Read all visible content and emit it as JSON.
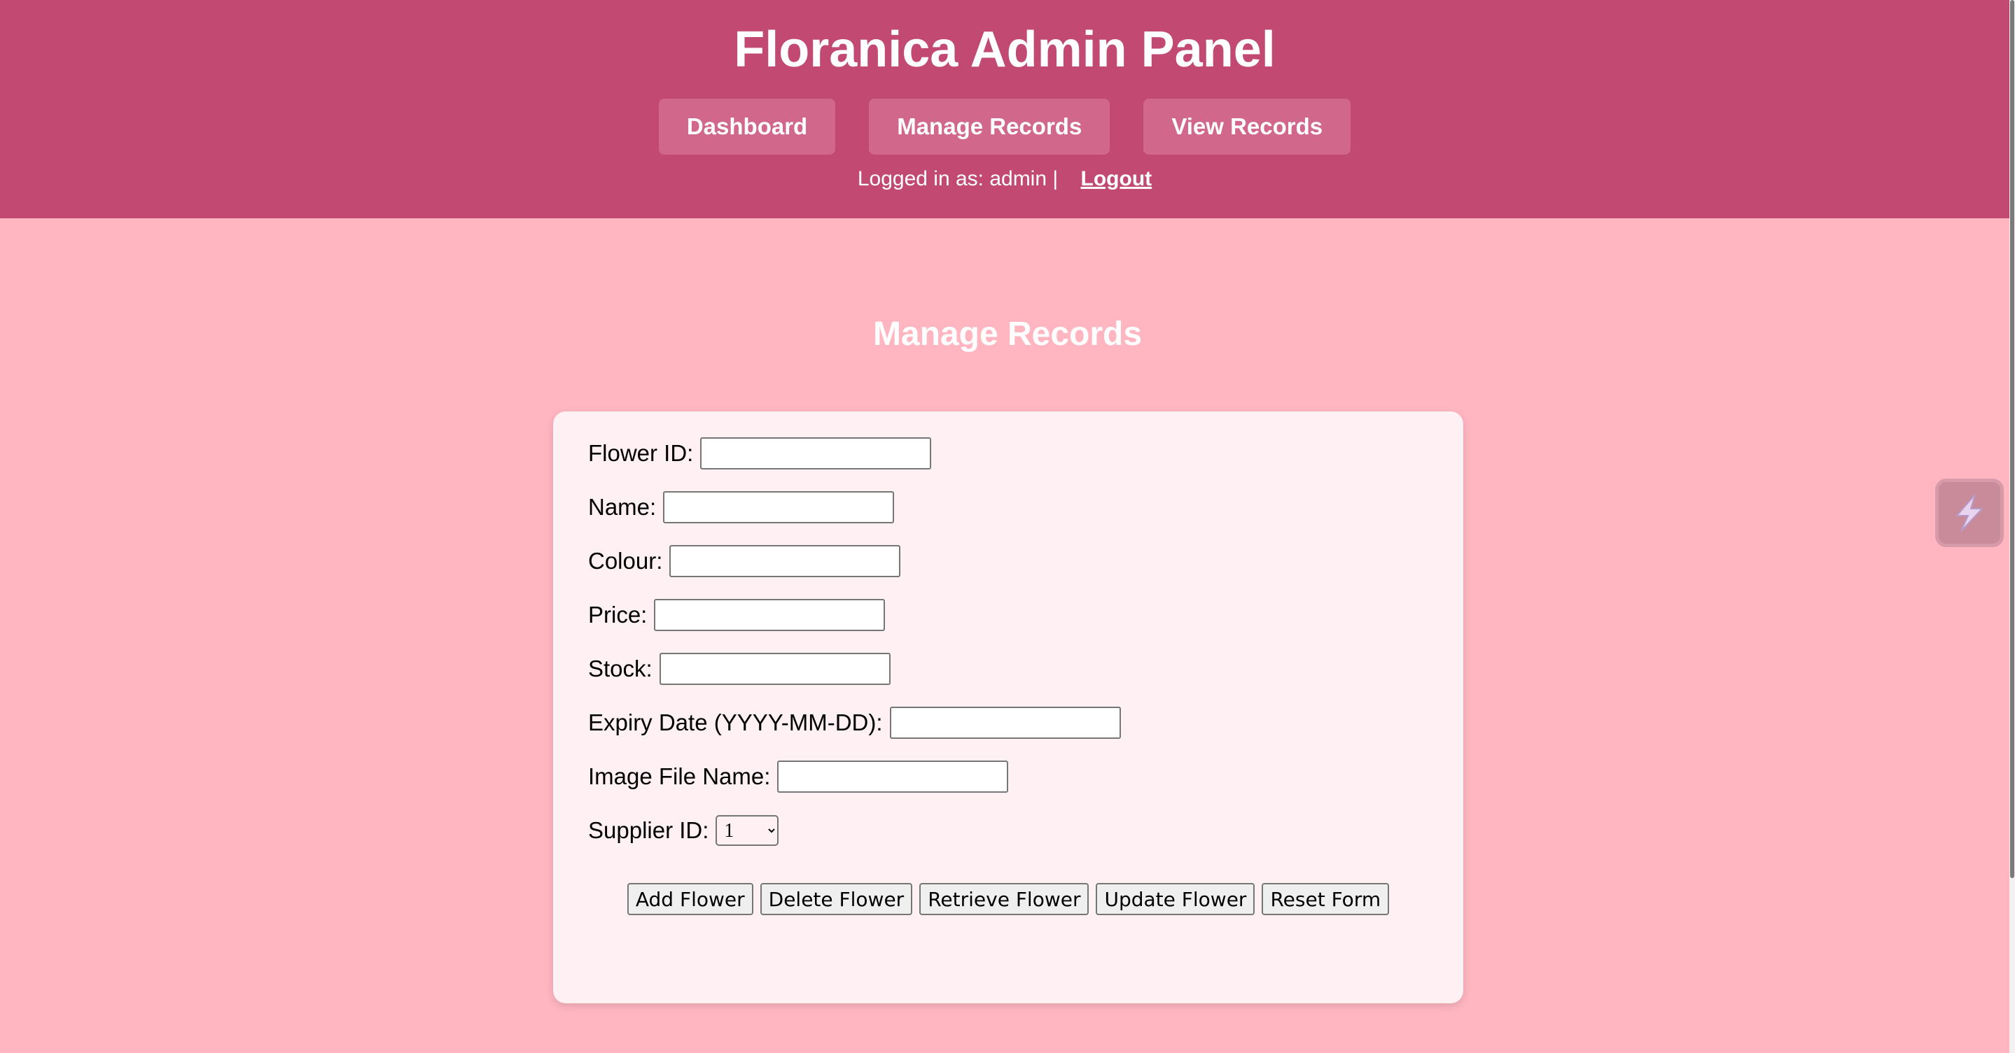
{
  "header": {
    "title": "Floranica Admin Panel",
    "nav": [
      {
        "label": "Dashboard"
      },
      {
        "label": "Manage Records"
      },
      {
        "label": "View Records"
      }
    ],
    "logged_in_text": "Logged in as: admin |",
    "logout_label": "Logout"
  },
  "main": {
    "title": "Manage Records",
    "form": {
      "fields": [
        {
          "label": "Flower ID:",
          "value": ""
        },
        {
          "label": "Name:",
          "value": ""
        },
        {
          "label": "Colour:",
          "value": ""
        },
        {
          "label": "Price:",
          "value": ""
        },
        {
          "label": "Stock:",
          "value": ""
        },
        {
          "label": "Expiry Date (YYYY-MM-DD):",
          "value": ""
        },
        {
          "label": "Image File Name:",
          "value": ""
        }
      ],
      "supplier": {
        "label": "Supplier ID:",
        "selected": "1"
      },
      "buttons": [
        {
          "label": "Add Flower"
        },
        {
          "label": "Delete Flower"
        },
        {
          "label": "Retrieve Flower"
        },
        {
          "label": "Update Flower"
        },
        {
          "label": "Reset Form"
        }
      ]
    }
  },
  "widget": {
    "icon": "extension-lightning-icon"
  },
  "colors": {
    "header_bg": "#c24a72",
    "nav_button_bg": "#d1688c",
    "page_bg": "#ffb6c1",
    "card_bg": "#fff0f3"
  }
}
